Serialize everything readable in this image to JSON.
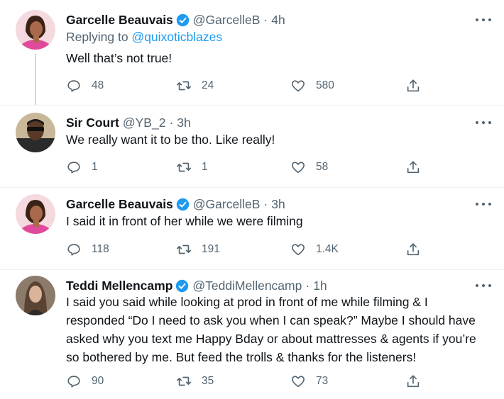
{
  "tweets": [
    {
      "author": "Garcelle Beauvais",
      "handle": "@GarcelleB",
      "separator": "·",
      "time": "4h",
      "verified": true,
      "replying_prefix": "Replying to",
      "replying_to": "@quixoticblazes",
      "text": "Well that’s not true!",
      "replies": "48",
      "retweets": "24",
      "likes": "580"
    },
    {
      "author": "Sir Court",
      "handle": "@YB_2",
      "separator": "·",
      "time": "3h",
      "verified": false,
      "text": "We really want it to be tho. Like really!",
      "replies": "1",
      "retweets": "1",
      "likes": "58"
    },
    {
      "author": "Garcelle Beauvais",
      "handle": "@GarcelleB",
      "separator": "·",
      "time": "3h",
      "verified": true,
      "text": "I said it in front of her while we were filming",
      "replies": "118",
      "retweets": "191",
      "likes": "1.4K"
    },
    {
      "author": "Teddi Mellencamp",
      "handle": "@TeddiMellencamp",
      "separator": "·",
      "time": "1h",
      "verified": true,
      "text_lines": [
        "I said you said while looking at prod in front of me while filming & I",
        "responded “Do I need to ask you when I can speak?” Maybe I should have",
        "asked why you text me Happy Bday or about mattresses & agents if you’re",
        "so bothered by me. But feed the trolls & thanks for the listeners!"
      ],
      "replies": "90",
      "retweets": "35",
      "likes": "73"
    }
  ],
  "colors": {
    "text": "#0f1419",
    "secondary": "#536471",
    "link": "#1d9bf0",
    "verified": "#1d9bf0",
    "thread_line": "#cfd9de"
  },
  "icons": [
    "reply-icon",
    "retweet-icon",
    "like-icon",
    "share-icon",
    "more-icon",
    "verified-badge-icon"
  ]
}
